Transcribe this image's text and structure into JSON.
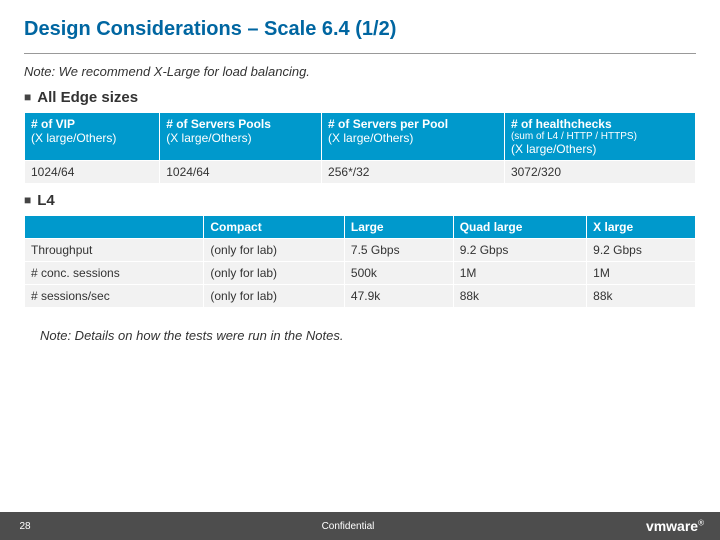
{
  "title": "Design Considerations – Scale 6.4 (1/2)",
  "topNote": "Note: We recommend X-Large for load balancing.",
  "section1": "All Edge sizes",
  "t1": {
    "h1a": "# of VIP",
    "h1b": "(X large/Others)",
    "h2a": "# of Servers Pools",
    "h2b": "(X large/Others)",
    "h3a": "# of Servers per Pool",
    "h3b": "(X large/Others)",
    "h4a": "# of healthchecks",
    "h4b": "(sum of L4 / HTTP / HTTPS)",
    "h4c": "(X large/Others)",
    "c1": "1024/64",
    "c2": "1024/64",
    "c3": "256*/32",
    "c4": "3072/320"
  },
  "section2": "L4",
  "t2": {
    "h1": "",
    "h2": "Compact",
    "h3": "Large",
    "h4": "Quad large",
    "h5": "X large",
    "r1": "Throughput",
    "r1c2": "(only for lab)",
    "r1c3": "7.5 Gbps",
    "r1c4": "9.2 Gbps",
    "r1c5": "9.2 Gbps",
    "r2": "# conc. sessions",
    "r2c2": "(only for lab)",
    "r2c3": "500k",
    "r2c4": "1M",
    "r2c5": "1M",
    "r3": "# sessions/sec",
    "r3c2": "(only for lab)",
    "r3c3": "47.9k",
    "r3c4": "88k",
    "r3c5": "88k"
  },
  "bottomNote": "Note: Details on how the tests were run in the Notes.",
  "footer": {
    "page": "28",
    "conf": "Confidential",
    "logo": "vmware"
  }
}
